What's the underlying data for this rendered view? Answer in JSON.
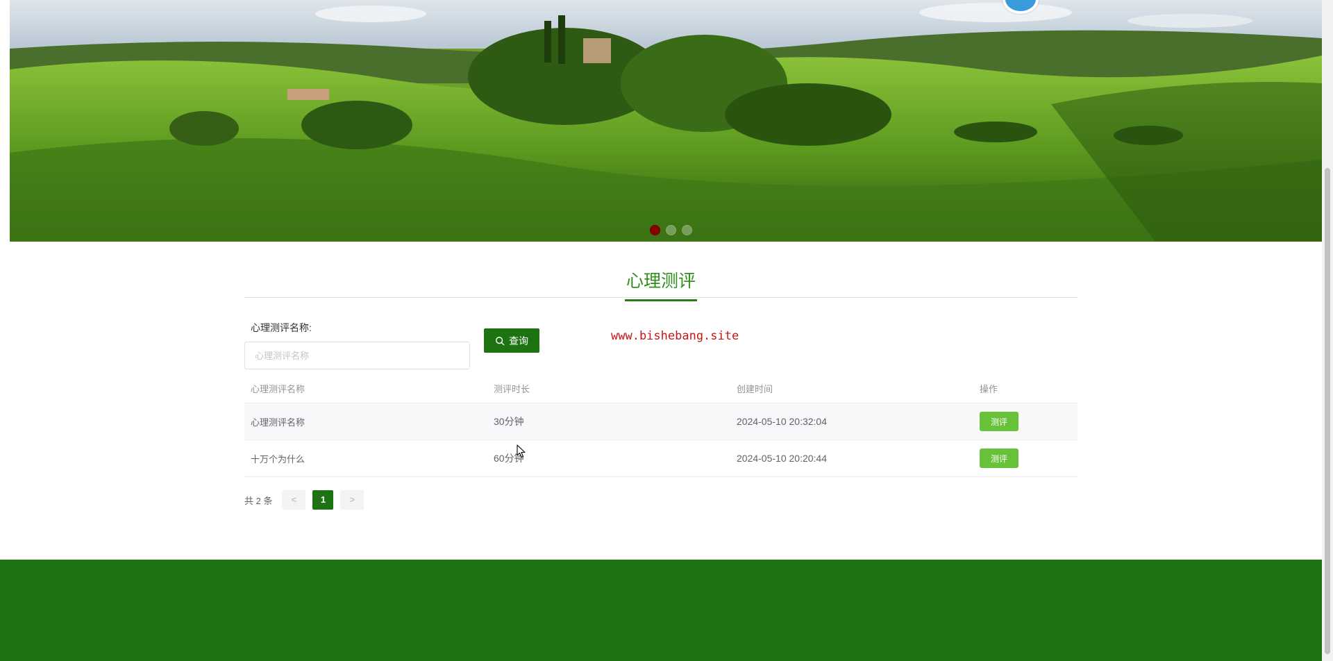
{
  "banner": {
    "slides": [
      {
        "active": true
      },
      {
        "active": false
      },
      {
        "active": false
      }
    ]
  },
  "section": {
    "title": "心理测评"
  },
  "search": {
    "label": "心理测评名称:",
    "placeholder": "心理测评名称",
    "value": "",
    "button_label": "查询",
    "icon": "search-icon"
  },
  "watermark": "www.bishebang.site",
  "table": {
    "columns": [
      "心理测评名称",
      "测评时长",
      "创建时间",
      "操作"
    ],
    "rows": [
      {
        "name": "心理测评名称",
        "duration": "30分钟",
        "created": "2024-05-10 20:32:04",
        "action": "测评"
      },
      {
        "name": "十万个为什么",
        "duration": "60分钟",
        "created": "2024-05-10 20:20:44",
        "action": "测评"
      }
    ]
  },
  "pagination": {
    "total": "共 2 条",
    "prev": "<",
    "current": "1",
    "next": ">"
  },
  "colors": {
    "primary": "#1d7312",
    "title": "#2f8f1c",
    "action_button": "#67c23a",
    "watermark": "#c81414",
    "active_dot": "#8b0000"
  }
}
